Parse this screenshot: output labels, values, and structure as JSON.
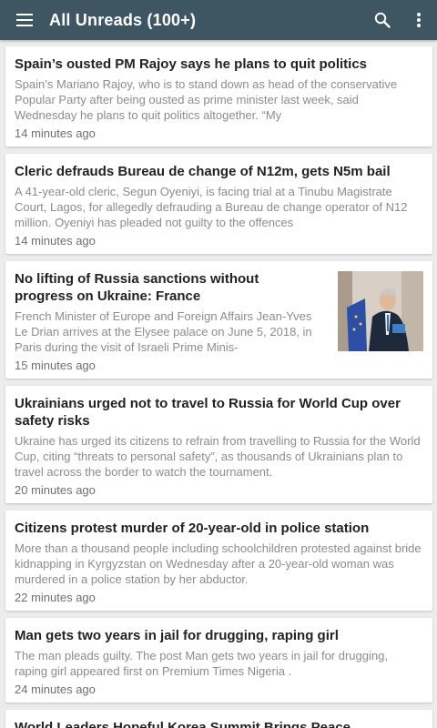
{
  "app": {
    "title": "All Unreads (100+)"
  },
  "articles": [
    {
      "title": "Spain’s ousted PM Rajoy says he plans to quit politics",
      "summary": "Spain’s Mariano Rajoy, who is to stand down as head of the conservative Popular Party after being ousted as prime minister last week, said Wednesday he plans to quit politics altogether. “My",
      "time": "14 minutes ago"
    },
    {
      "title": "Cleric defrauds Bureau de change of N12m, gets N5m bail",
      "summary": "A 41-year-old cleric,  Segun Oyeniyi, is facing trial at a Tinubu Magistrate Court, Lagos, for allegedly defrauding a Bureau de change operator of N12 million. Oyeniyi has pleaded not guilty to the offences",
      "time": "14 minutes ago"
    },
    {
      "title": "No lifting of Russia sanctions without progress on Ukraine: France",
      "summary": "French Minister of Europe and Foreign Affairs Jean-Yves Le Drian arrives at the Elysee palace on June 5, 2018, in Paris during the visit of Israeli Prime Minis-",
      "time": "15 minutes ago"
    },
    {
      "title": "Ukrainians urged not to travel to Russia for World Cup over safety risks",
      "summary": "Ukraine has urged its citizens to refrain from travelling to Russia for the World Cup, citing “threats to personal safety”, as thousands of Ukrainians plan to travel across the border to watch the tournament.",
      "time": "20 minutes ago"
    },
    {
      "title": "Citizens protest murder of  20-year-old in police station",
      "summary": "More than a thousand people including schoolchildren protested against bride kidnapping in Kyrgyzstan on Wednesday after a 20-year-old woman was murdered in a police station by her abductor.",
      "time": "22 minutes ago"
    },
    {
      "title": "Man gets two years in jail for drugging, raping girl",
      "summary": "The man pleads guilty. The post Man gets two years in jail for drugging, raping girl appeared first on Premium Times Nigeria .",
      "time": "24 minutes ago"
    }
  ],
  "partial_next_title": "World Leaders Hopeful Korea Summit Brings Peace"
}
